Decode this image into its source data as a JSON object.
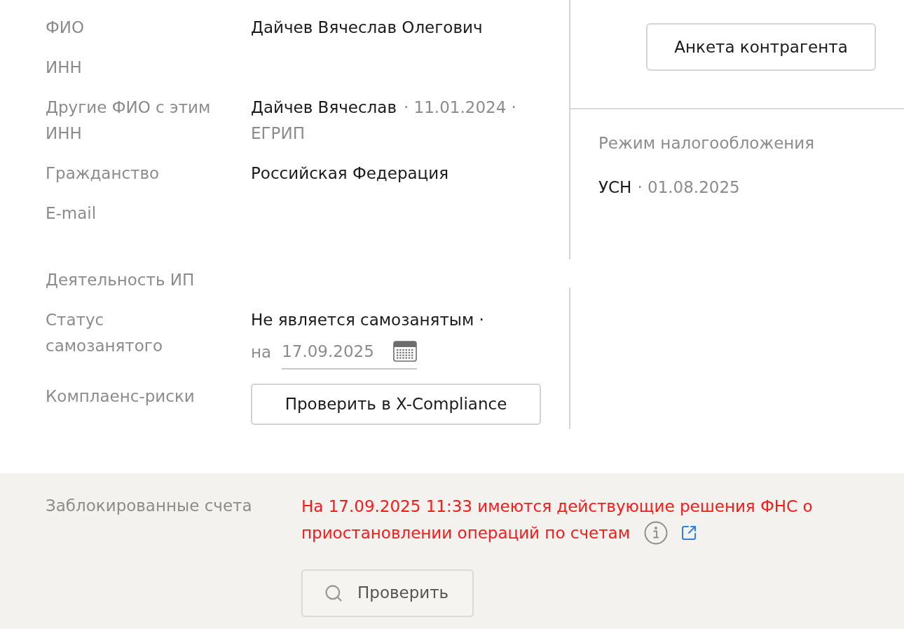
{
  "details": {
    "sections": [
      {
        "rows": [
          {
            "kind": "text",
            "label": "ФИО",
            "value": "Дайчев Вячеслав Олегович"
          },
          {
            "kind": "empty",
            "label": "ИНН"
          },
          {
            "kind": "other_names",
            "label": "Другие ФИО с этим ИНН",
            "name": "Дайчев Вячеслав",
            "date": "· 11.01.2024 ·",
            "source": "ЕГРИП"
          },
          {
            "kind": "text",
            "label": "Гражданство",
            "value": "Российская Федерация"
          },
          {
            "kind": "empty",
            "label": "E-mail"
          }
        ]
      },
      {
        "rows": [
          {
            "kind": "empty",
            "label": "Деятельность ИП"
          },
          {
            "kind": "status",
            "label": "Статус самозанятого",
            "value": "Не является самозанятым ·",
            "date_prefix": "на",
            "date": "17.09.2025"
          },
          {
            "kind": "button",
            "label": "Комплаенс-риски",
            "button": "Проверить в X-Compliance"
          }
        ]
      }
    ]
  },
  "side_panel": {
    "button": "Анкета контрагента",
    "tax_regime": {
      "label": "Режим налогообложения",
      "value": "УСН",
      "date": "· 01.08.2025"
    }
  },
  "blocked_accounts": {
    "label": "Заблокированные счета",
    "message": "На 17.09.2025 11:33 имеются действующие решения ФНС о приостановлении операций по счетам",
    "button": "Проверить"
  }
}
